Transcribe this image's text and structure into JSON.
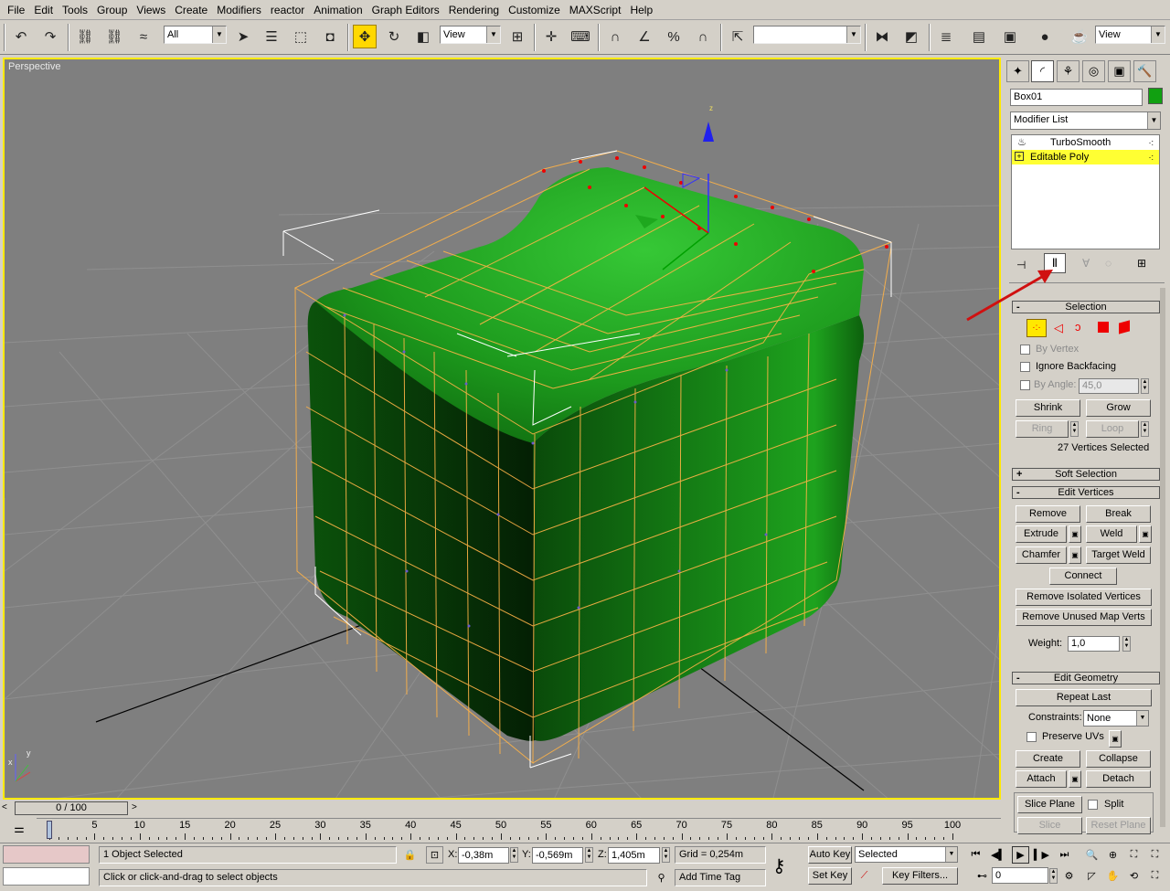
{
  "menu": [
    "File",
    "Edit",
    "Tools",
    "Group",
    "Views",
    "Create",
    "Modifiers",
    "reactor",
    "Animation",
    "Graph Editors",
    "Rendering",
    "Customize",
    "MAXScript",
    "Help"
  ],
  "toolbar": {
    "selection_filter": "All",
    "ref_coord_left": "View",
    "named_selection": "",
    "ref_coord_right": "View"
  },
  "viewport": {
    "label": "Perspective",
    "axis_z": "z",
    "axis_y": "y",
    "axis_x": "x"
  },
  "command_panel": {
    "object_name": "Box01",
    "object_color": "#11a011",
    "modifier_list": "Modifier List",
    "stack": [
      {
        "label": "TurboSmooth",
        "selected": false
      },
      {
        "label": "Editable Poly",
        "selected": true
      }
    ],
    "selection": {
      "title": "Selection",
      "by_vertex": "By Vertex",
      "ignore_backfacing": "Ignore Backfacing",
      "by_angle": "By Angle:",
      "angle_value": "45,0",
      "shrink": "Shrink",
      "grow": "Grow",
      "ring": "Ring",
      "loop": "Loop",
      "status": "27 Vertices Selected"
    },
    "soft_selection": "Soft Selection",
    "edit_vertices": {
      "title": "Edit Vertices",
      "remove": "Remove",
      "break": "Break",
      "extrude": "Extrude",
      "weld": "Weld",
      "chamfer": "Chamfer",
      "target_weld": "Target Weld",
      "connect": "Connect",
      "remove_isolated": "Remove Isolated Vertices",
      "remove_unused": "Remove Unused Map Verts",
      "weight_label": "Weight:",
      "weight_value": "1,0"
    },
    "edit_geometry": {
      "title": "Edit Geometry",
      "repeat_last": "Repeat Last",
      "constraints_label": "Constraints:",
      "constraints_value": "None",
      "preserve_uvs": "Preserve UVs",
      "create": "Create",
      "collapse": "Collapse",
      "attach": "Attach",
      "detach": "Detach",
      "slice_plane": "Slice Plane",
      "split": "Split",
      "slice": "Slice",
      "reset_plane": "Reset Plane"
    }
  },
  "timeline": {
    "slider_label": "0 / 100",
    "ticks": [
      0,
      5,
      10,
      15,
      20,
      25,
      30,
      35,
      40,
      45,
      50,
      55,
      60,
      65,
      70,
      75,
      80,
      85,
      90,
      95,
      100
    ]
  },
  "status": {
    "objects_selected": "1 Object Selected",
    "prompt": "Click or click-and-drag to select objects",
    "x_label": "X:",
    "x_value": "-0,38m",
    "y_label": "Y:",
    "y_value": "-0,569m",
    "z_label": "Z:",
    "z_value": "1,405m",
    "grid": "Grid = 0,254m",
    "add_time_tag": "Add Time Tag",
    "auto_key": "Auto Key",
    "set_key": "Set Key",
    "key_mode": "Selected",
    "key_filters": "Key Filters...",
    "frame": "0"
  }
}
